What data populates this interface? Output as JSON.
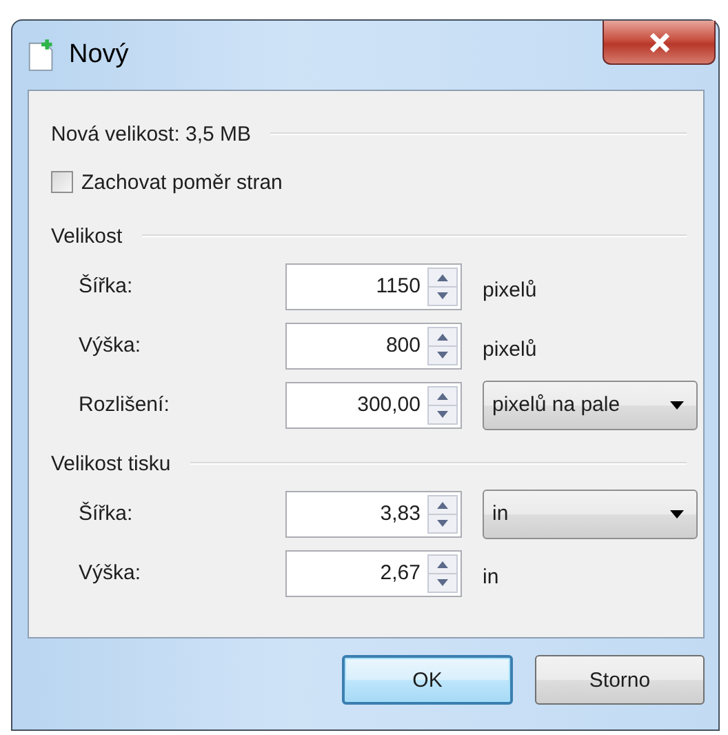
{
  "window": {
    "title": "Nový"
  },
  "summary": "Nová velikost: 3,5 MB",
  "keep_aspect": {
    "label": "Zachovat poměr stran",
    "checked": false
  },
  "sections": [
    {
      "title": "Velikost",
      "rows": [
        {
          "label": "Šířka:",
          "value": "1150",
          "unit": {
            "kind": "text",
            "text": "pixelů"
          }
        },
        {
          "label": "Výška:",
          "value": "800",
          "unit": {
            "kind": "text",
            "text": "pixelů"
          }
        },
        {
          "label": "Rozlišení:",
          "value": "300,00",
          "unit": {
            "kind": "dropdown",
            "text": "pixelů na pale"
          }
        }
      ]
    },
    {
      "title": "Velikost tisku",
      "rows": [
        {
          "label": "Šířka:",
          "value": "3,83",
          "unit": {
            "kind": "dropdown",
            "text": "in"
          }
        },
        {
          "label": "Výška:",
          "value": "2,67",
          "unit": {
            "kind": "text",
            "text": "in"
          }
        }
      ]
    }
  ],
  "buttons": [
    {
      "label": "OK",
      "default": true
    },
    {
      "label": "Storno",
      "default": false
    }
  ]
}
